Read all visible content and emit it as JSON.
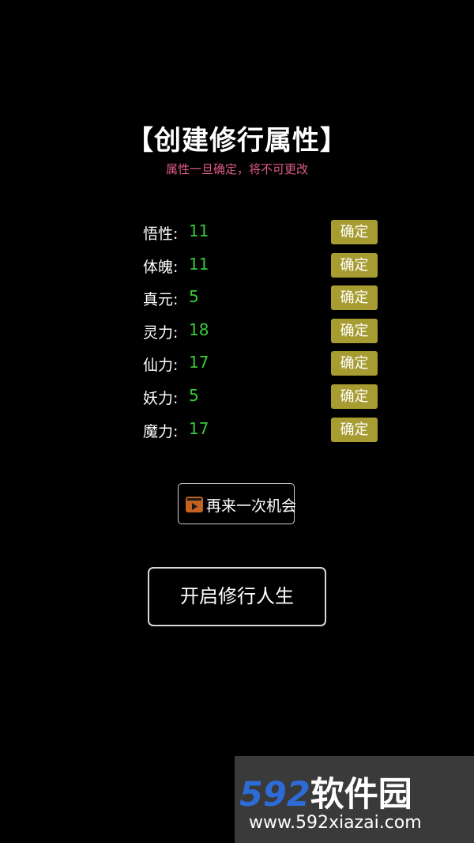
{
  "header": {
    "title": "【创建修行属性】",
    "subtitle": "属性一旦确定，将不可更改"
  },
  "attributes": [
    {
      "label": "悟性:",
      "value": "11",
      "button": "确定"
    },
    {
      "label": "体魄:",
      "value": "11",
      "button": "确定"
    },
    {
      "label": "真元:",
      "value": "5",
      "button": "确定"
    },
    {
      "label": "灵力:",
      "value": "18",
      "button": "确定"
    },
    {
      "label": "仙力:",
      "value": "17",
      "button": "确定"
    },
    {
      "label": "妖力:",
      "value": "5",
      "button": "确定"
    },
    {
      "label": "魔力:",
      "value": "17",
      "button": "确定"
    }
  ],
  "retry": {
    "label": "再来一次机会",
    "icon": "video-play-icon"
  },
  "start": {
    "label": "开启修行人生"
  },
  "watermark": {
    "logo_number": "592",
    "logo_text": "软件园",
    "url": "www.592xiazai.com"
  },
  "colors": {
    "background": "#000000",
    "value_green": "#39c93a",
    "button_olive": "#a79c31",
    "subtitle_pink": "#e05a87",
    "icon_orange": "#c4621f"
  }
}
